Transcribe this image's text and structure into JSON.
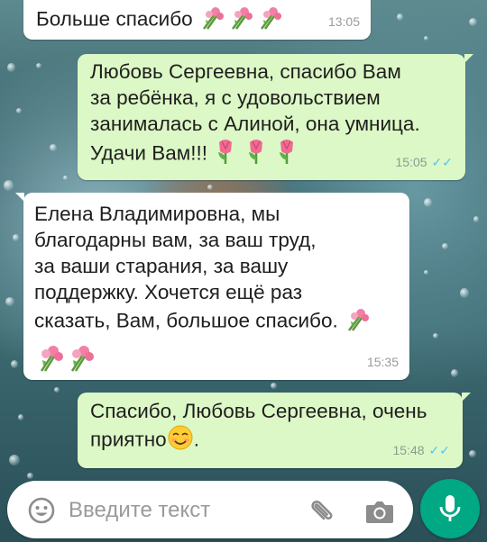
{
  "messages": [
    {
      "id": "m1",
      "direction": "in",
      "text": "Больше спасибо",
      "emoji": [
        "bouquet",
        "bouquet",
        "bouquet"
      ],
      "time": "13:05",
      "ticks": ""
    },
    {
      "id": "m2",
      "direction": "out",
      "text": "Любовь Сергеевна, спасибо Вам\nза ребёнка, я с удовольствием\nзанималась с Алиной, она умница.\nУдачи Вам!!!",
      "emoji": [
        "tulip",
        "tulip",
        "tulip"
      ],
      "time": "15:05",
      "ticks": "✓✓"
    },
    {
      "id": "m3",
      "direction": "in",
      "text": "Елена Владимировна, мы\nблагодарны вам, за ваш труд,\nза ваши старания, за вашу\nподдержку. Хочется ещё раз\nсказать, Вам, большое спасибо.",
      "emoji": [
        "bouquet",
        "bouquet",
        "bouquet"
      ],
      "time": "15:35",
      "ticks": ""
    },
    {
      "id": "m4",
      "direction": "out",
      "text": "Спасибо, Любовь Сергеевна, очень\nприятно",
      "suffix": ".",
      "emoji": [
        "smiling-face"
      ],
      "time": "15:48",
      "ticks": "✓✓"
    }
  ],
  "input": {
    "placeholder": "Введите текст"
  },
  "icons": {
    "emoji": "smiley-icon",
    "attach": "paperclip-icon",
    "camera": "camera-icon",
    "mic": "microphone-icon"
  },
  "colors": {
    "outgoing": "#dcf8c6",
    "incoming": "#ffffff",
    "accent": "#00a884",
    "read_ticks": "#4fc3f7"
  }
}
